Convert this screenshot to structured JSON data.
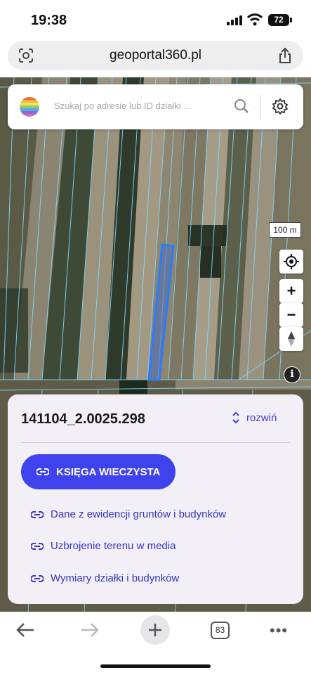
{
  "status_bar": {
    "time": "19:38",
    "battery": "72",
    "icons": [
      "signal-icon",
      "wifi-icon",
      "battery-icon"
    ]
  },
  "browser": {
    "url": "geoportal360.pl",
    "left_icon": "reader-icon",
    "right_icon": "share-icon",
    "tab_count": "83"
  },
  "map": {
    "search_placeholder": "Szukaj po adresie lub ID działki ...",
    "scale_label": "100 m",
    "controls": [
      "locate-icon",
      "zoom-in-icon",
      "zoom-out-icon",
      "compass-icon",
      "info-icon"
    ],
    "zoom_in_label": "+",
    "zoom_out_label": "−",
    "info_label": "i",
    "highlight_color": "#2a7cff",
    "parcel_line_color": "#7fd8ff"
  },
  "parcel": {
    "id": "141104_2.0025.298",
    "expand_label": "rozwiń",
    "land_register_button": "KSIĘGA WIECZYSTA",
    "links": [
      "Dane z ewidencji gruntów i budynków",
      "Uzbrojenie terenu w media",
      "Wymiary działki i budynków"
    ]
  },
  "colors": {
    "accent": "#3f43ee",
    "link": "#3236c8",
    "sheet_background": "#f3eff6"
  }
}
